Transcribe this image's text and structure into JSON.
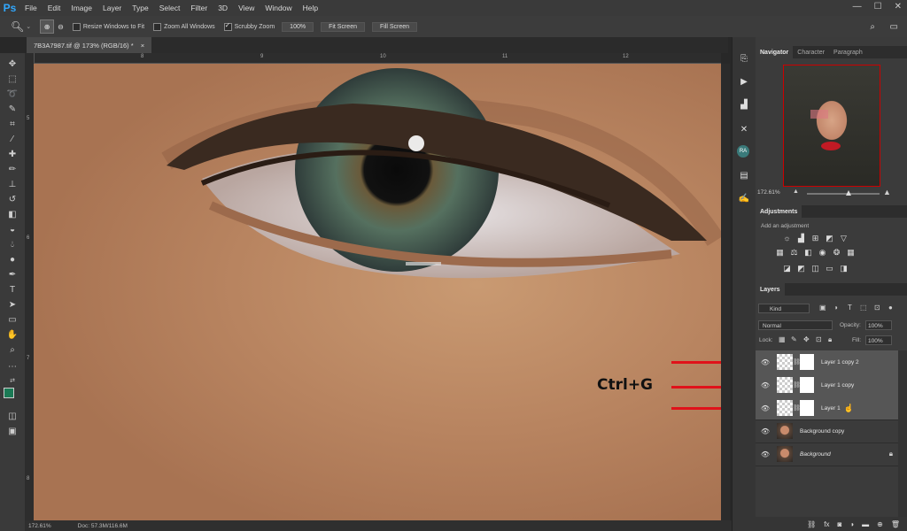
{
  "menubar": {
    "logo": "Ps",
    "items": [
      "File",
      "Edit",
      "Image",
      "Layer",
      "Type",
      "Select",
      "Filter",
      "3D",
      "View",
      "Window",
      "Help"
    ]
  },
  "options_bar": {
    "resize_windows": "Resize Windows to Fit",
    "zoom_all": "Zoom All Windows",
    "scrubby": "Scrubby Zoom",
    "zoom_value": "100%",
    "fit_screen": "Fit Screen",
    "fill_screen": "Fill Screen"
  },
  "document": {
    "tab_title": "7B3A7987.tif @ 173% (RGB/16) *",
    "close": "×"
  },
  "rulers": {
    "top": [
      "8",
      "9",
      "10",
      "11",
      "12"
    ],
    "left": [
      "5",
      "6",
      "7",
      "8"
    ]
  },
  "status": {
    "zoom": "172.61%",
    "doc": "Doc: 57.3M/116.6M"
  },
  "annotation": {
    "text": "Ctrl+G",
    "arrow_color": "#e0121a"
  },
  "navigator": {
    "tabs": [
      "Navigator",
      "Character",
      "Paragraph"
    ],
    "zoom": "172.61%"
  },
  "adjustments": {
    "title": "Adjustments",
    "subtitle": "Add an adjustment",
    "icons": [
      "brightness-icon",
      "levels-icon",
      "curves-icon",
      "exposure-icon",
      "vibrance-icon",
      "hue-saturation-icon",
      "color-balance-icon",
      "black-white-icon",
      "photo-filter-icon",
      "channel-mixer-icon",
      "color-lookup-icon",
      "invert-icon",
      "posterize-icon",
      "threshold-icon",
      "gradient-map-icon",
      "selective-color-icon"
    ]
  },
  "layers": {
    "title": "Layers",
    "kind": "Kind",
    "blend_mode": "Normal",
    "opacity_label": "Opacity:",
    "opacity_value": "100%",
    "lock_label": "Lock:",
    "fill_label": "Fill:",
    "fill_value": "100%",
    "rows": [
      {
        "name": "Layer 1 copy 2",
        "selected": true,
        "type": "mask"
      },
      {
        "name": "Layer 1 copy",
        "selected": true,
        "type": "mask"
      },
      {
        "name": "Layer 1",
        "selected": true,
        "type": "mask"
      },
      {
        "name": "Background copy",
        "selected": false,
        "type": "photo"
      },
      {
        "name": "Background",
        "selected": false,
        "type": "photo"
      }
    ]
  }
}
